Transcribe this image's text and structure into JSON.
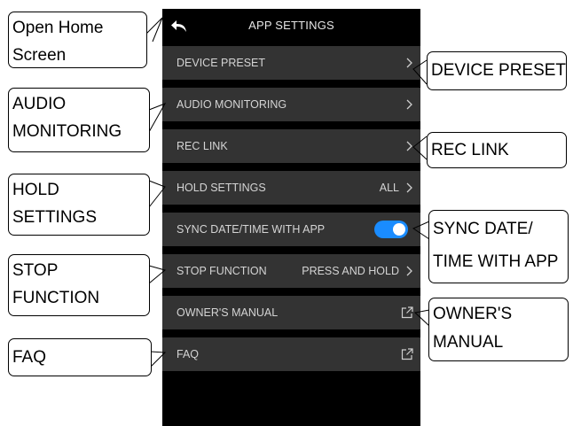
{
  "app": {
    "title": "APP SETTINGS",
    "back_icon": "back-arrow-icon",
    "accent_color": "#1a8cff",
    "rows": [
      {
        "label": "DEVICE PRESET",
        "value": "",
        "trailing": "chevron-right-icon"
      },
      {
        "label": "AUDIO MONITORING",
        "value": "",
        "trailing": "chevron-right-icon"
      },
      {
        "label": "REC LINK",
        "value": "",
        "trailing": "chevron-right-icon"
      },
      {
        "label": "HOLD SETTINGS",
        "value": "ALL",
        "trailing": "chevron-right-icon"
      },
      {
        "label": "SYNC DATE/TIME WITH APP",
        "toggle_on": true,
        "trailing": "toggle-switch"
      },
      {
        "label": "STOP FUNCTION",
        "value": "PRESS AND HOLD",
        "trailing": "chevron-right-icon"
      },
      {
        "label": "OWNER'S MANUAL",
        "value": "",
        "trailing": "external-link-icon"
      },
      {
        "label": "FAQ",
        "value": "",
        "trailing": "external-link-icon"
      }
    ]
  },
  "callouts": {
    "left": [
      {
        "lines": [
          "Open Home",
          "Screen"
        ]
      },
      {
        "lines": [
          "AUDIO",
          "MONITORING"
        ]
      },
      {
        "lines": [
          "HOLD",
          "SETTINGS"
        ]
      },
      {
        "lines": [
          "STOP",
          "FUNCTION"
        ]
      },
      {
        "lines": [
          "FAQ"
        ]
      }
    ],
    "right": [
      {
        "lines": [
          "DEVICE PRESET"
        ]
      },
      {
        "lines": [
          "REC LINK"
        ]
      },
      {
        "lines": [
          "SYNC DATE/",
          "TIME WITH APP"
        ]
      },
      {
        "lines": [
          "OWNER'S",
          "MANUAL"
        ]
      }
    ]
  }
}
